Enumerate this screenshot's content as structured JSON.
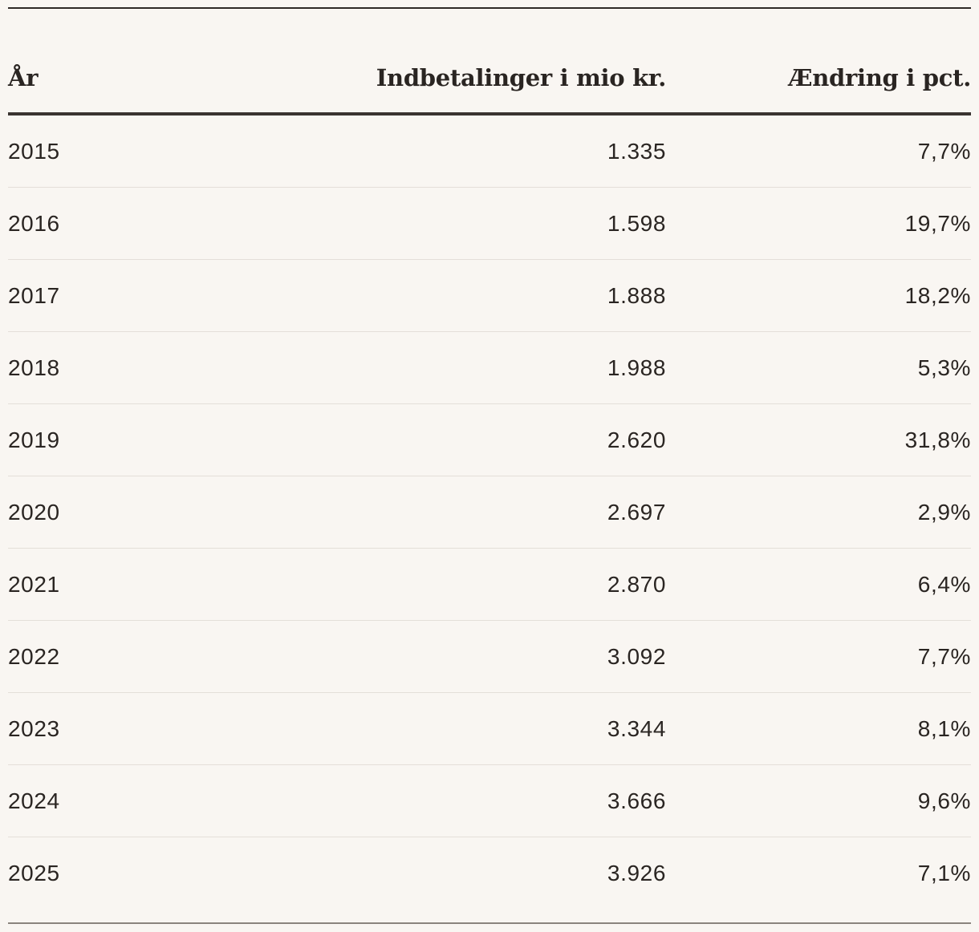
{
  "table": {
    "headers": {
      "year": "År",
      "amount": "Indbetalinger i mio kr.",
      "change": "Ændring i pct."
    },
    "rows": [
      {
        "year": "2015",
        "amount": "1.335",
        "change": "7,7%"
      },
      {
        "year": "2016",
        "amount": "1.598",
        "change": "19,7%"
      },
      {
        "year": "2017",
        "amount": "1.888",
        "change": "18,2%"
      },
      {
        "year": "2018",
        "amount": "1.988",
        "change": "5,3%"
      },
      {
        "year": "2019",
        "amount": "2.620",
        "change": "31,8%"
      },
      {
        "year": "2020",
        "amount": "2.697",
        "change": "2,9%"
      },
      {
        "year": "2021",
        "amount": "2.870",
        "change": "6,4%"
      },
      {
        "year": "2022",
        "amount": "3.092",
        "change": "7,7%"
      },
      {
        "year": "2023",
        "amount": "3.344",
        "change": "8,1%"
      },
      {
        "year": "2024",
        "amount": "3.666",
        "change": "9,6%"
      },
      {
        "year": "2025",
        "amount": "3.926",
        "change": "7,1%"
      }
    ]
  },
  "colors": {
    "background": "#f9f6f2",
    "text": "#2a2522",
    "rule": "#3a3431",
    "row_divider": "#e4dfd9"
  }
}
